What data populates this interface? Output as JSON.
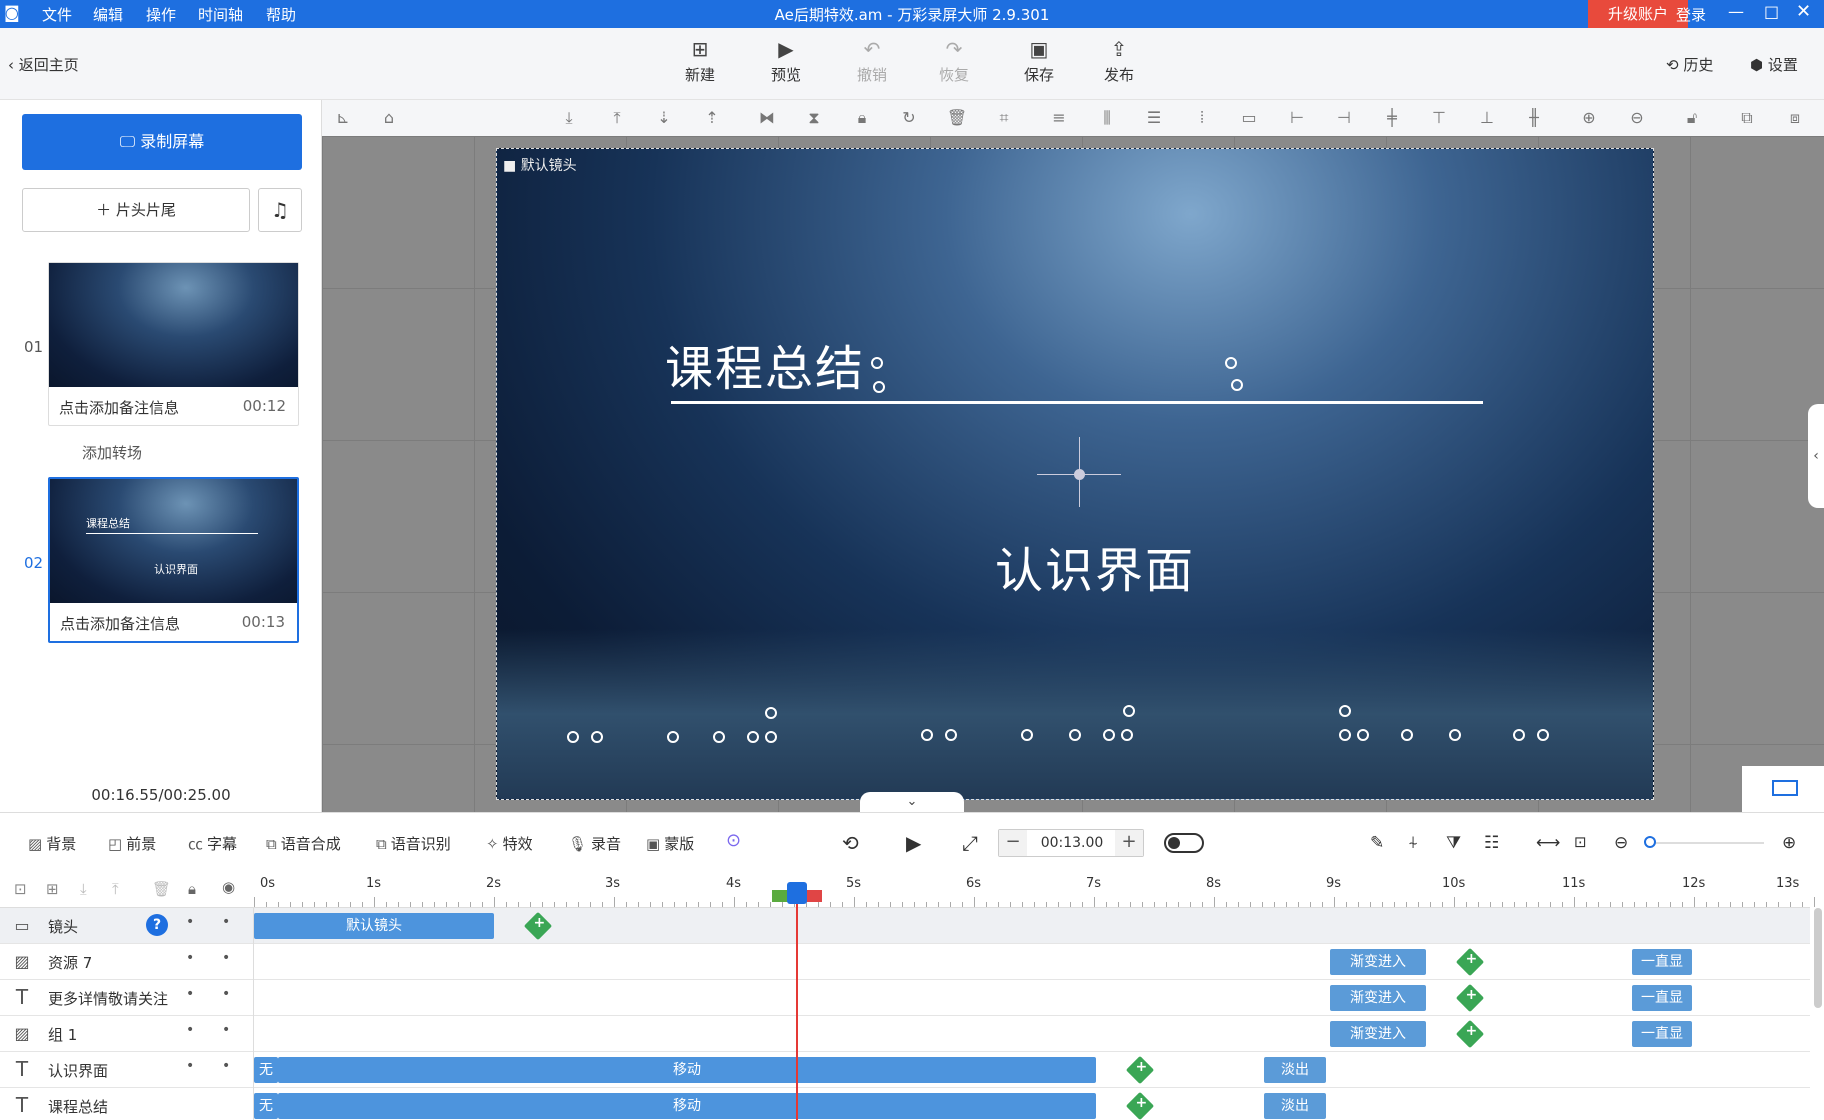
{
  "titlebar": {
    "title": "Ae后期特效.am - 万彩录屏大师 2.9.301",
    "menus": [
      "文件",
      "编辑",
      "操作",
      "时间轴",
      "帮助"
    ],
    "upgrade": "升级账户",
    "login": "登录"
  },
  "topbar": {
    "back": "返回主页",
    "buttons": [
      {
        "label": "新建",
        "icon": "new-icon"
      },
      {
        "label": "预览",
        "icon": "play-icon"
      },
      {
        "label": "撤销",
        "icon": "undo-icon"
      },
      {
        "label": "恢复",
        "icon": "redo-icon"
      },
      {
        "label": "保存",
        "icon": "save-icon"
      },
      {
        "label": "发布",
        "icon": "publish-icon"
      }
    ],
    "history": "历史",
    "settings": "设置"
  },
  "left": {
    "record": "录制屏幕",
    "intro": "片头片尾",
    "add_transition": "添加转场",
    "scenes": [
      {
        "num": "01",
        "note": "点击添加备注信息",
        "duration": "00:12",
        "thumb_title": "",
        "thumb_sub": ""
      },
      {
        "num": "02",
        "note": "点击添加备注信息",
        "duration": "00:13",
        "thumb_title": "课程总结",
        "thumb_sub": "认识界面"
      }
    ],
    "time_counter": "00:16.55/00:25.00"
  },
  "stage": {
    "camera_label": "默认镜头",
    "title1": "课程总结",
    "title2": "认识界面"
  },
  "tl_toolbar": {
    "items": [
      "背景",
      "前景",
      "字幕",
      "语音合成",
      "语音识别",
      "特效",
      "录音",
      "蒙版"
    ],
    "time_value": "00:13.00"
  },
  "timeline": {
    "ruler": [
      "0s",
      "1s",
      "2s",
      "3s",
      "4s",
      "5s",
      "6s",
      "7s",
      "8s",
      "9s",
      "10s",
      "11s",
      "12s",
      "13s"
    ],
    "tracks": [
      {
        "name": "镜头",
        "icon": "camera-icon"
      },
      {
        "name": "资源 7",
        "icon": "image-icon"
      },
      {
        "name": "更多详情敬请关注",
        "icon": "text-icon"
      },
      {
        "name": "组 1",
        "icon": "image-icon"
      },
      {
        "name": "认识界面",
        "icon": "text-icon"
      },
      {
        "name": "课程总结",
        "icon": "text-icon"
      }
    ],
    "clips": {
      "camera": "默认镜头",
      "fade_in": "渐变进入",
      "always": "一直显",
      "none": "无",
      "move": "移动",
      "fade_out": "淡出"
    }
  }
}
